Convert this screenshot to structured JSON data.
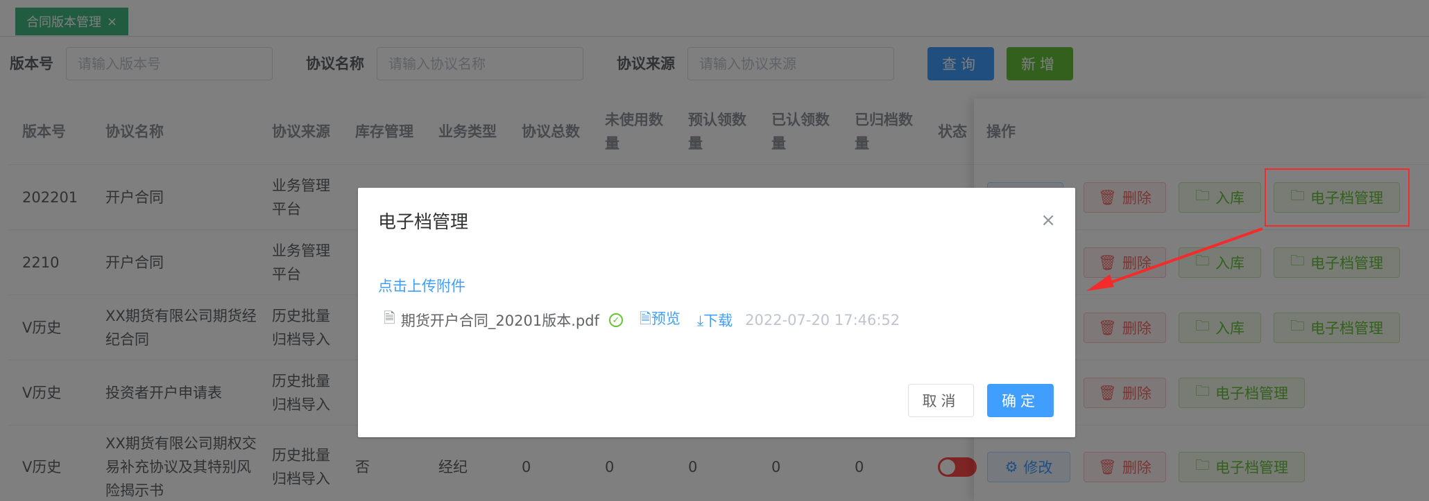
{
  "tabs": [
    {
      "label": "合同版本管理",
      "close": "×"
    }
  ],
  "search": {
    "version_label": "版本号",
    "version_placeholder": "请输入版本号",
    "name_label": "协议名称",
    "name_placeholder": "请输入协议名称",
    "source_label": "协议来源",
    "source_placeholder": "请输入协议来源",
    "query_button": "查询",
    "add_button": "新增"
  },
  "table": {
    "headers": [
      "版本号",
      "协议名称",
      "协议来源",
      "库存管理",
      "业务类型",
      "协议总数",
      "未使用数量",
      "预认领数量",
      "已认领数量",
      "已归档数量",
      "状态",
      "操作"
    ],
    "rows": [
      {
        "version": "202201",
        "name": "开户合同",
        "source": "业务管理平台",
        "stock": "",
        "type": "",
        "total": "",
        "unused": "",
        "pre": "",
        "claimed": "",
        "archived": "",
        "status": "on",
        "ops": [
          "删除",
          "入库",
          "电子档管理"
        ]
      },
      {
        "version": "2210",
        "name": "开户合同",
        "source": "业务管理平台",
        "stock": "",
        "type": "",
        "total": "",
        "unused": "",
        "pre": "",
        "claimed": "",
        "archived": "",
        "status": "",
        "ops": [
          "删除",
          "入库",
          "电子档管理"
        ]
      },
      {
        "version": "V历史",
        "name": "XX期货有限公司期货经纪合同",
        "source": "历史批量归档导入",
        "stock": "",
        "type": "",
        "total": "",
        "unused": "",
        "pre": "",
        "claimed": "",
        "archived": "",
        "status": "",
        "ops": [
          "删除",
          "入库",
          "电子档管理"
        ]
      },
      {
        "version": "V历史",
        "name": "投资者开户申请表",
        "source": "历史批量归档导入",
        "stock": "",
        "type": "",
        "total": "",
        "unused": "",
        "pre": "",
        "claimed": "",
        "archived": "",
        "status": "",
        "ops": [
          "删除",
          "电子档管理"
        ]
      },
      {
        "version": "V历史",
        "name": "XX期货有限公司期权交易补充协议及其特别风险揭示书",
        "source": "历史批量归档导入",
        "stock": "否",
        "type": "经纪",
        "total": "0",
        "unused": "0",
        "pre": "0",
        "claimed": "0",
        "archived": "0",
        "status": "off",
        "ops": [
          "修改",
          "删除",
          "电子档管理"
        ]
      }
    ]
  },
  "dialog": {
    "title": "电子档管理",
    "close": "×",
    "upload_link": "点击上传附件",
    "file_name": "期货开户合同_20201版本.pdf",
    "preview": "预览",
    "download": "下载",
    "timestamp": "2022-07-20 17:46:52",
    "cancel": "取消",
    "confirm": "确定"
  },
  "colors": {
    "primary": "#409eff",
    "success": "#67c23a",
    "danger": "#f56c6c",
    "tab": "#42b983",
    "annotation": "#f32b2b"
  }
}
